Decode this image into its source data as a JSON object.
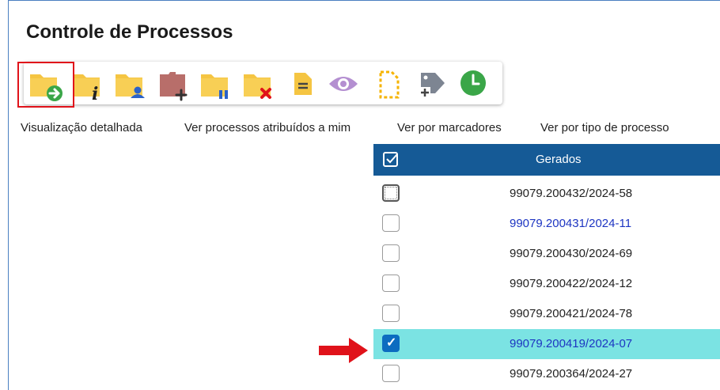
{
  "page": {
    "title": "Controle de Processos"
  },
  "toolbar": {
    "buttons": [
      {
        "icon": "folder-arrow-right-icon"
      },
      {
        "icon": "folder-info-icon"
      },
      {
        "icon": "folder-user-icon"
      },
      {
        "icon": "folder-plus-icon"
      },
      {
        "icon": "folder-pause-icon"
      },
      {
        "icon": "folder-x-icon"
      },
      {
        "icon": "note-icon"
      },
      {
        "icon": "eye-icon"
      },
      {
        "icon": "dashed-document-icon"
      },
      {
        "icon": "tag-plus-icon"
      },
      {
        "icon": "clock-icon"
      }
    ]
  },
  "links": {
    "detailed_view": "Visualização detalhada",
    "assigned_to_me": "Ver processos atribuídos a mim",
    "by_markers": "Ver por marcadores",
    "by_type": "Ver por tipo de processo"
  },
  "table": {
    "header": "Gerados",
    "rows": [
      {
        "number": "99079.200432/2024-58",
        "checked": false,
        "highlight": false,
        "link_blue": false,
        "focused": true
      },
      {
        "number": "99079.200431/2024-11",
        "checked": false,
        "highlight": false,
        "link_blue": true
      },
      {
        "number": "99079.200430/2024-69",
        "checked": false,
        "highlight": false,
        "link_blue": false
      },
      {
        "number": "99079.200422/2024-12",
        "checked": false,
        "highlight": false,
        "link_blue": false
      },
      {
        "number": "99079.200421/2024-78",
        "checked": false,
        "highlight": false,
        "link_blue": false
      },
      {
        "number": "99079.200419/2024-07",
        "checked": true,
        "highlight": true,
        "link_blue": true
      },
      {
        "number": "99079.200364/2024-27",
        "checked": false,
        "highlight": false,
        "link_blue": false
      }
    ]
  },
  "colors": {
    "header_bg": "#155a96",
    "selected_row": "#7be3e3",
    "annotation_red": "#e0121a",
    "folder": "#f5c542"
  }
}
